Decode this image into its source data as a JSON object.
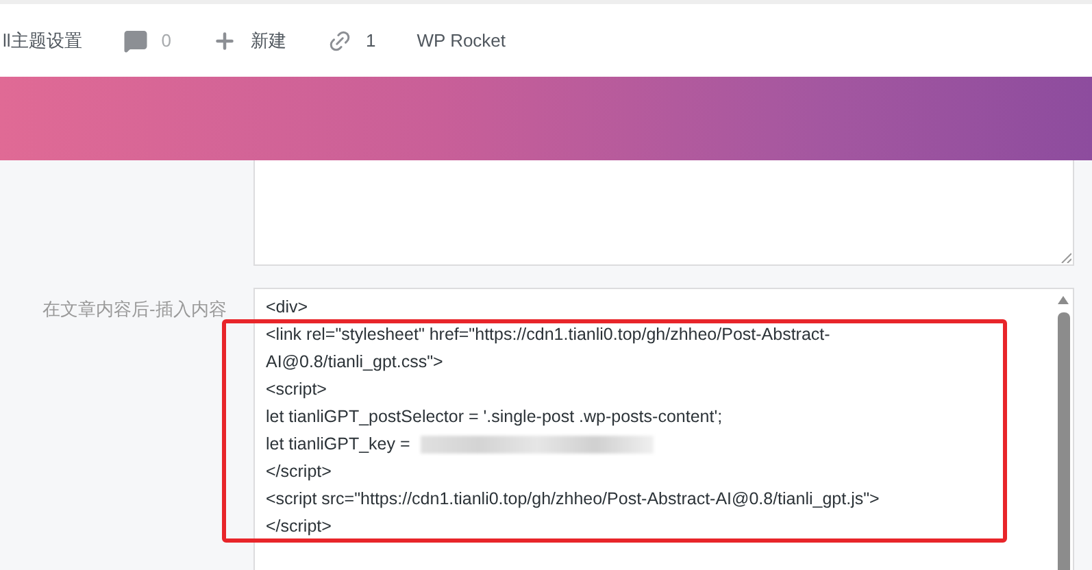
{
  "admin_bar": {
    "items": [
      {
        "kind": "text",
        "label": "ll主题设置"
      },
      {
        "kind": "comment",
        "label": "0"
      },
      {
        "kind": "new",
        "label": "新建"
      },
      {
        "kind": "link",
        "label": "1"
      },
      {
        "kind": "text",
        "label": "WP Rocket"
      }
    ]
  },
  "fields": [
    {
      "label": "在文章内容后-插入内容",
      "lines": [
        {
          "text": "<div>"
        },
        {
          "text": "<link rel=\"stylesheet\" href=\"https://cdn1.tianli0.top/gh/zhheo/Post-Abstract-"
        },
        {
          "text": "AI@0.8/tianli_gpt.css\">"
        },
        {
          "text": "<script>"
        },
        {
          "text": "let tianliGPT_postSelector = '.single-post .wp-posts-content';"
        },
        {
          "text": "let tianliGPT_key =",
          "redacted": true
        },
        {
          "text": "</script>"
        },
        {
          "text": "<script src=\"https://cdn1.tianli0.top/gh/zhheo/Post-Abstract-AI@0.8/tianli_gpt.js\">"
        },
        {
          "text": "</script>"
        }
      ]
    }
  ]
}
